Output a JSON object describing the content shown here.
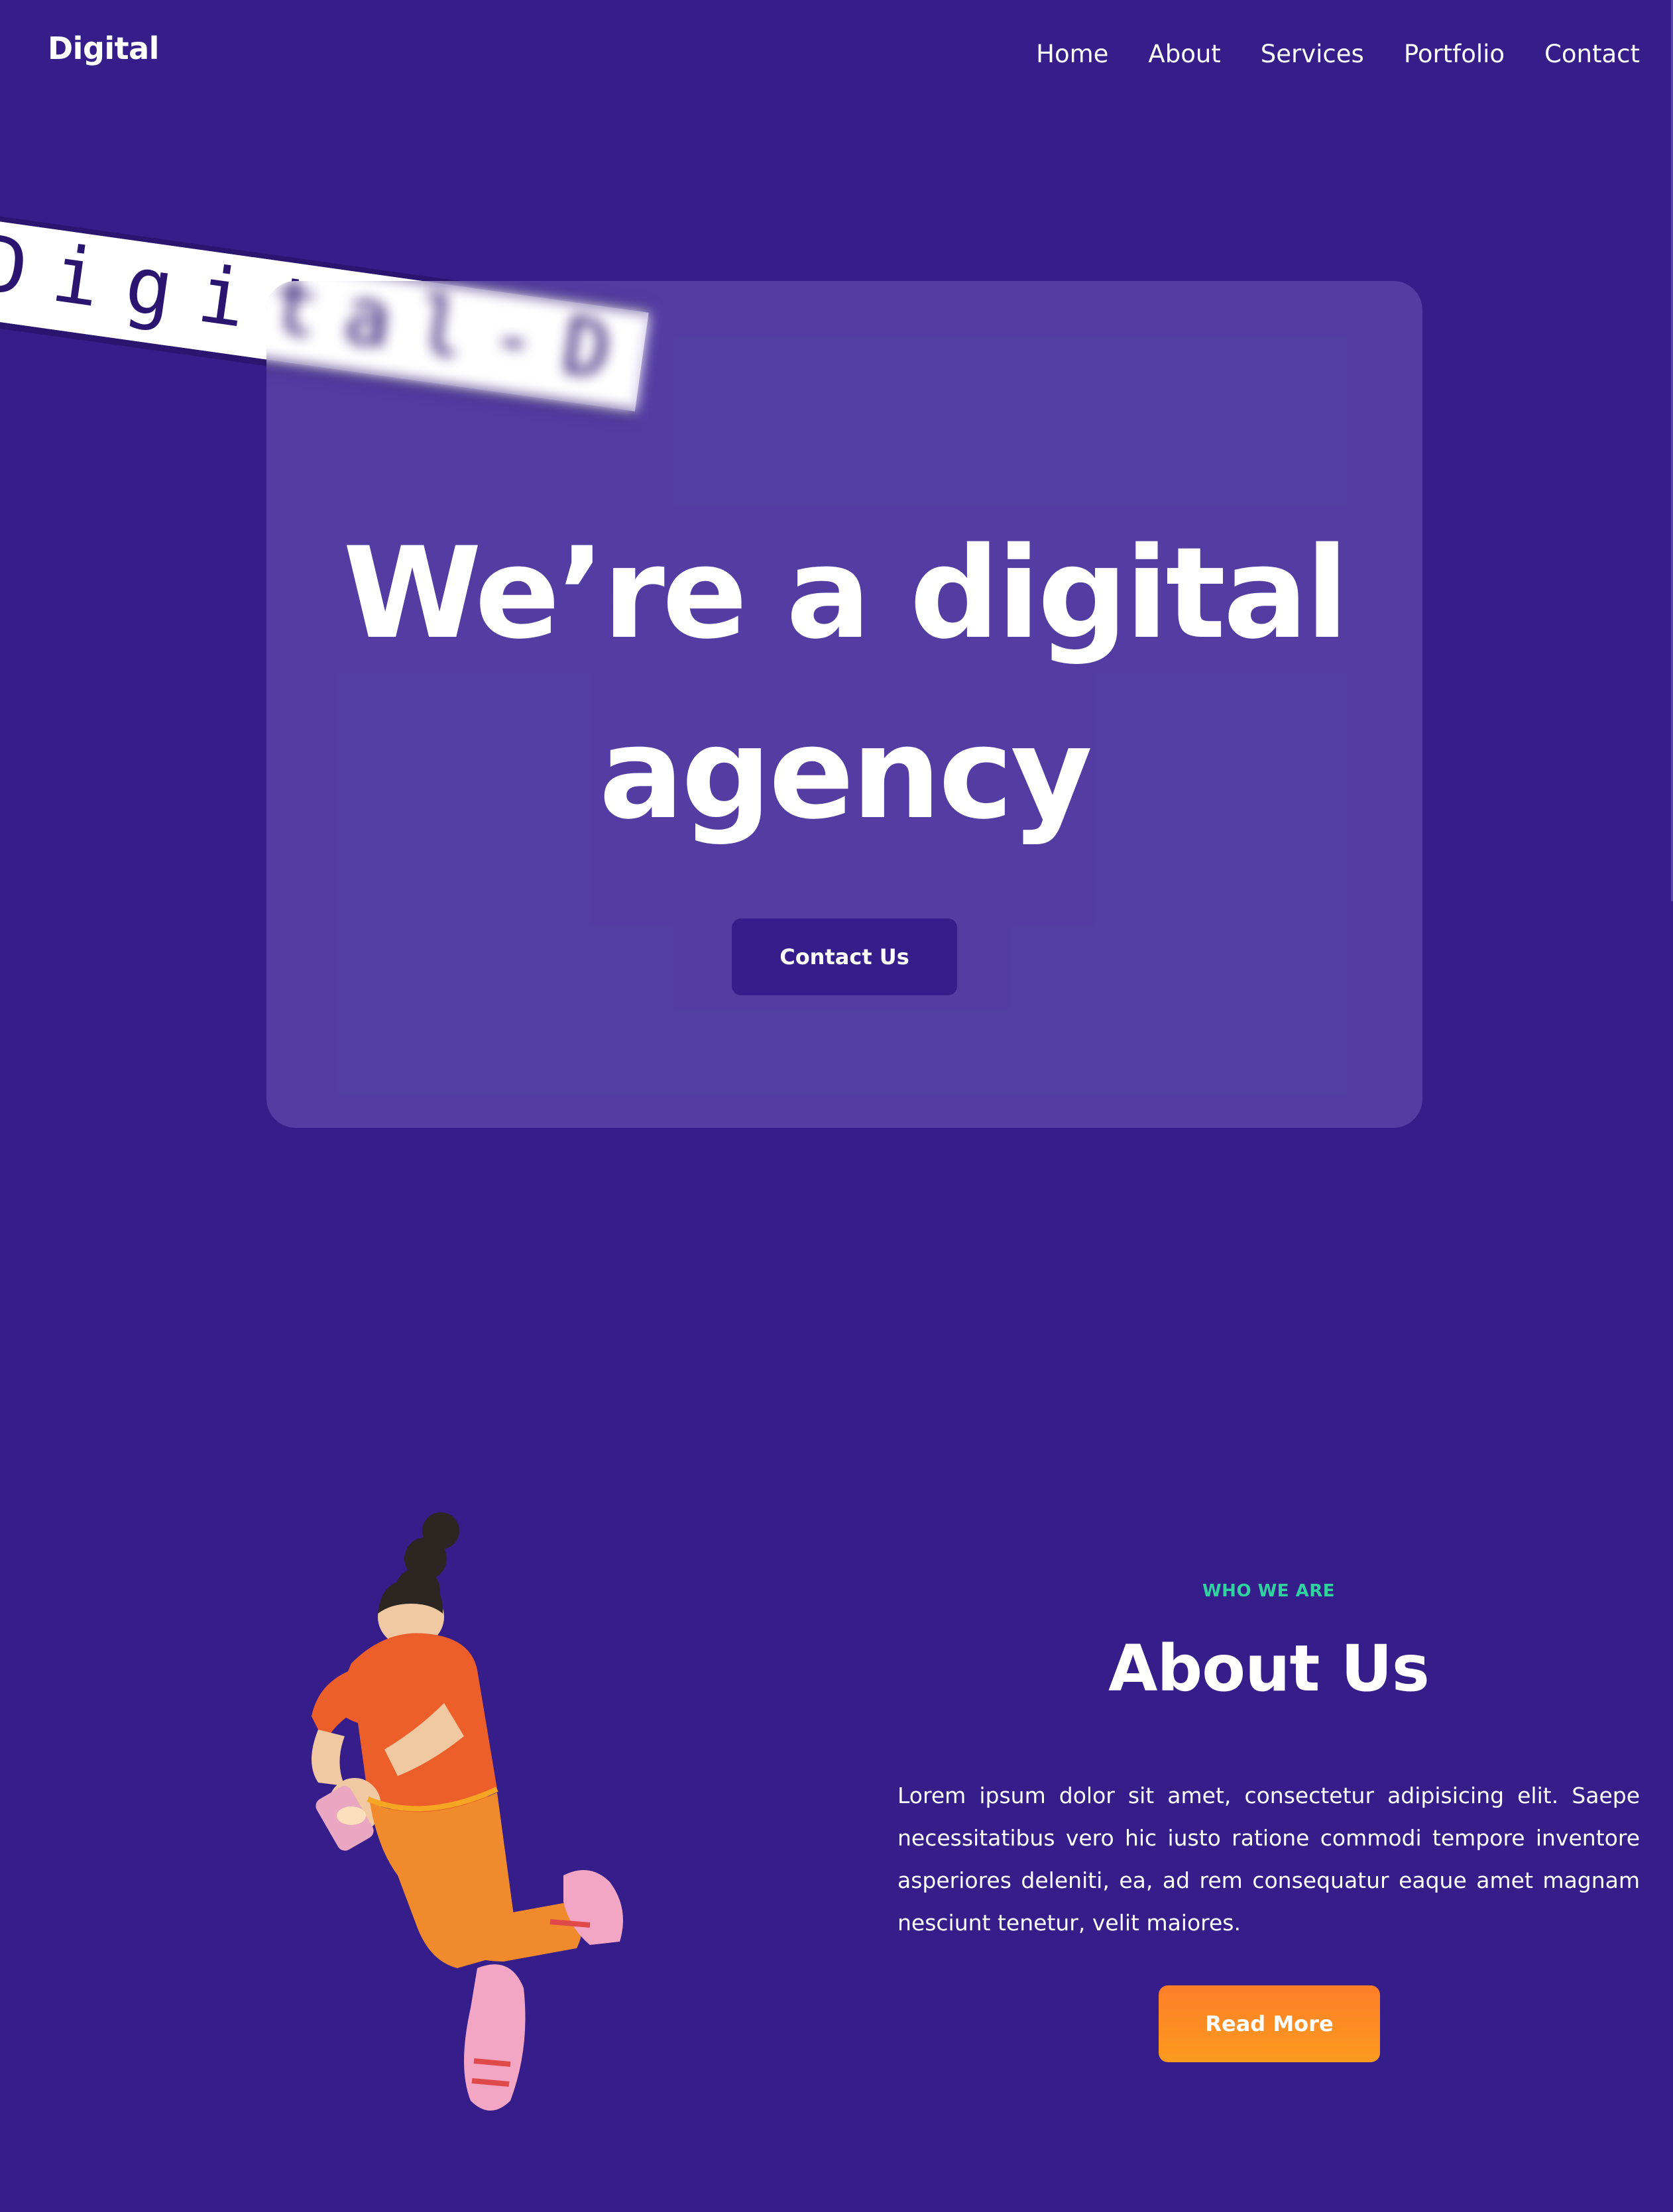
{
  "header": {
    "logo": "Digital",
    "nav": [
      "Home",
      "About",
      "Services",
      "Portfolio",
      "Contact"
    ]
  },
  "hero": {
    "ribbon_text": "Digital-D",
    "title_line1": "We’re a digital",
    "title_line2": "agency",
    "cta_label": "Contact Us"
  },
  "about": {
    "eyebrow": "WHO WE ARE",
    "title": "About Us",
    "body": "Lorem ipsum dolor sit amet, consectetur adipisicing elit. Saepe necessitatibus vero hic iusto ratione commodi tempore inventore asperiores deleniti, ea, ad rem consequatur eaque amet magnam nesciunt tenetur, velit maiores.",
    "cta_label": "Read More"
  },
  "colors": {
    "background": "#351e8a",
    "card": "#4a3697",
    "accent_green": "#2fd3a0",
    "accent_orange": "#fd7e2a"
  },
  "icons": {
    "figure": "woman-with-phone-illustration"
  }
}
